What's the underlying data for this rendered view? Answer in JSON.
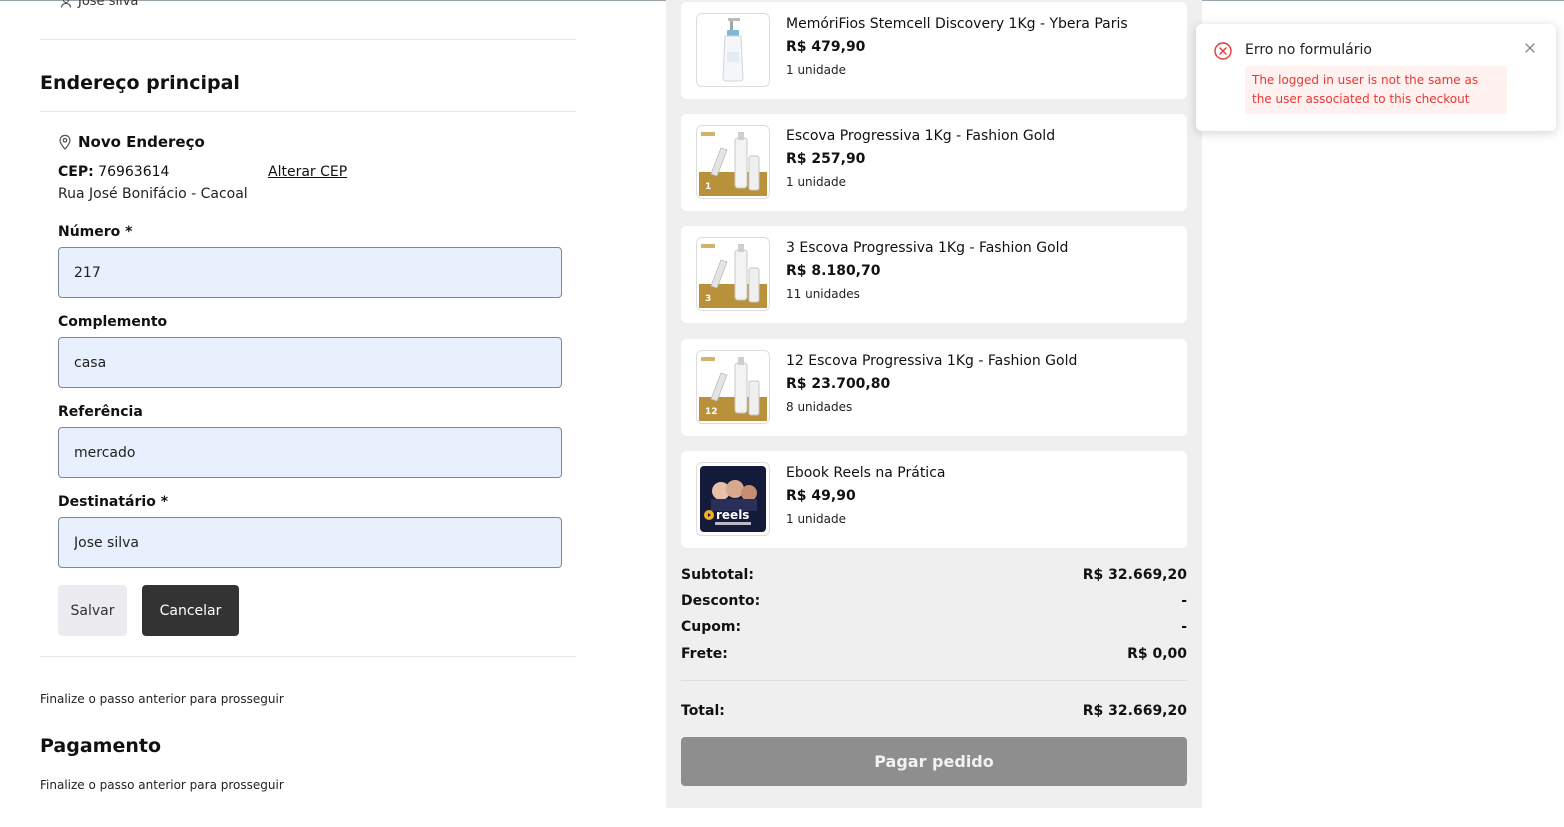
{
  "top_user": {
    "name": "Jose silva"
  },
  "address": {
    "title": "Endereço principal",
    "new_address_label": "Novo Endereço",
    "cep_label": "CEP:",
    "cep_value": "76963614",
    "change_cep": "Alterar CEP",
    "street": "Rua José Bonifácio - Cacoal",
    "fields": {
      "numero": {
        "label": "Número *",
        "value": "217"
      },
      "complemento": {
        "label": "Complemento",
        "value": "casa"
      },
      "referencia": {
        "label": "Referência",
        "value": "mercado"
      },
      "destinatario": {
        "label": "Destinatário *",
        "value": "Jose silva"
      }
    },
    "save_label": "Salvar",
    "cancel_label": "Cancelar"
  },
  "steps": {
    "hint_shipping": "Finalize o passo anterior para prosseguir",
    "payment_title": "Pagamento",
    "hint_payment": "Finalize o passo anterior para prosseguir"
  },
  "cart": {
    "items": [
      {
        "name": "MemóriFios Stemcell Discovery 1Kg - Ybera Paris",
        "price": "R$ 479,90",
        "qty": "1 unidade",
        "icon": "bottle"
      },
      {
        "name": "Escova Progressiva 1Kg - Fashion Gold",
        "price": "R$ 257,90",
        "qty": "1 unidade",
        "icon": "kit",
        "badge": "1"
      },
      {
        "name": "3 Escova Progressiva 1Kg - Fashion Gold",
        "price": "R$ 8.180,70",
        "qty": "11 unidades",
        "icon": "kit",
        "badge": "3"
      },
      {
        "name": "12 Escova Progressiva 1Kg - Fashion Gold",
        "price": "R$ 23.700,80",
        "qty": "8 unidades",
        "icon": "kit",
        "badge": "12"
      },
      {
        "name": "Ebook Reels na Prática",
        "price": "R$ 49,90",
        "qty": "1 unidade",
        "icon": "ebook",
        "badge": "reels"
      }
    ],
    "summary": {
      "subtotal_label": "Subtotal:",
      "subtotal_value": "R$ 32.669,20",
      "desconto_label": "Desconto:",
      "desconto_value": "-",
      "cupom_label": "Cupom:",
      "cupom_value": "-",
      "frete_label": "Frete:",
      "frete_value": "R$ 0,00",
      "total_label": "Total:",
      "total_value": "R$ 32.669,20"
    },
    "pay_label": "Pagar pedido"
  },
  "toast": {
    "title": "Erro no formulário",
    "message": "The logged in user is not the same as the user associated to this checkout"
  },
  "colors": {
    "panel_bg": "#efefef",
    "input_bg": "#e8f0fe",
    "button_dark": "#333333",
    "button_disabled": "#8e8e8e",
    "error": "#e53935",
    "gold": "#b8913a"
  }
}
